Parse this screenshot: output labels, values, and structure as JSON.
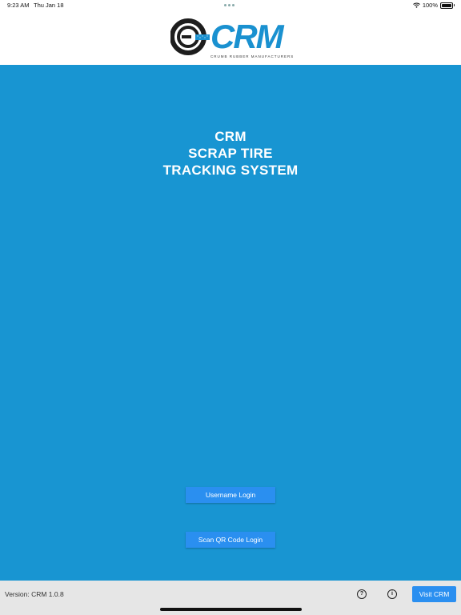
{
  "status_bar": {
    "time": "9:23 AM",
    "date": "Thu Jan 18",
    "battery": "100%"
  },
  "header": {
    "logo_text": "CRM",
    "logo_tagline": "CRUMB RUBBER MANUFACTURERS"
  },
  "main": {
    "title_lines": [
      "CRM",
      "SCRAP TIRE",
      "TRACKING SYSTEM"
    ],
    "username_login_label": "Username Login",
    "scan_qr_login_label": "Scan QR Code Login"
  },
  "footer": {
    "version": "Version: CRM 1.0.8",
    "help_icon": "?",
    "info_icon": "i",
    "visit_label": "Visit CRM"
  },
  "colors": {
    "brand_blue": "#1895d2",
    "button_blue": "#2a8ff0",
    "logo_dark": "#1d1d1d"
  }
}
